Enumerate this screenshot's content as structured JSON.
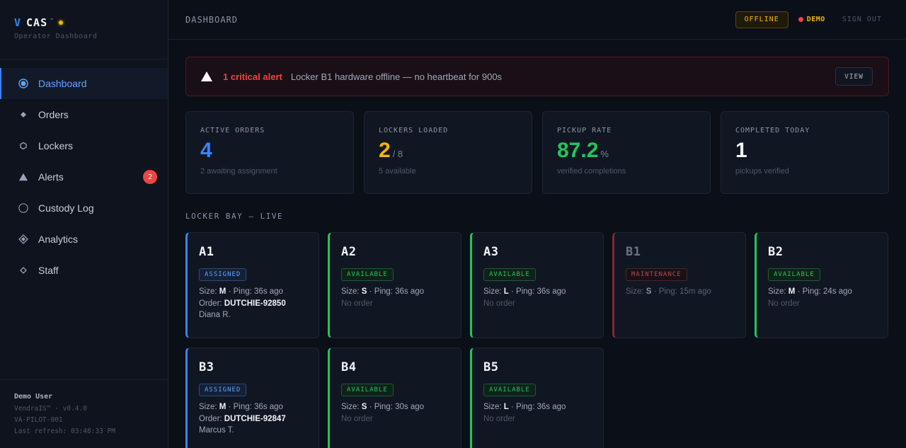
{
  "brand": {
    "v": "V",
    "name": "CAS",
    "tm": "™",
    "subtitle": "Operator Dashboard"
  },
  "nav": [
    {
      "label": "Dashboard",
      "icon": "radio-dot-icon",
      "active": true
    },
    {
      "label": "Orders",
      "icon": "diamond-icon"
    },
    {
      "label": "Lockers",
      "icon": "hexagon-icon"
    },
    {
      "label": "Alerts",
      "icon": "warning-triangle-icon",
      "badge": "2"
    },
    {
      "label": "Custody Log",
      "icon": "circle-icon"
    },
    {
      "label": "Analytics",
      "icon": "diamond-outline-icon"
    },
    {
      "label": "Staff",
      "icon": "small-diamond-icon"
    }
  ],
  "footer": {
    "user": "Demo User",
    "version": "VendraIS™ · v0.4.0",
    "site": "VA-PILOT-001",
    "refresh": "Last refresh: 03:48:33 PM"
  },
  "topbar": {
    "title": "DASHBOARD",
    "status": "OFFLINE",
    "demo": "DEMO",
    "signout": "SIGN OUT"
  },
  "alert": {
    "title": "1 critical alert",
    "message": "Locker B1 hardware offline — no heartbeat for 900s",
    "action": "VIEW"
  },
  "stats": [
    {
      "label": "ACTIVE ORDERS",
      "value": "4",
      "suffix": "",
      "sub": "2 awaiting assignment",
      "color": "#3b82f6"
    },
    {
      "label": "LOCKERS LOADED",
      "value": "2",
      "suffix": "/ 8",
      "sub": "5 available",
      "color": "#f5b400"
    },
    {
      "label": "PICKUP RATE",
      "value": "87.2",
      "suffix": "%",
      "sub": "verified completions",
      "color": "#22c55e"
    },
    {
      "label": "COMPLETED TODAY",
      "value": "1",
      "suffix": "",
      "sub": "pickups verified",
      "color": "#f2f4f8"
    }
  ],
  "bay": {
    "title": "LOCKER BAY — LIVE",
    "size_label": "Size:",
    "ping_label": "Ping:",
    "order_label": "Order:",
    "no_order": "No order",
    "lockers": [
      {
        "id": "A1",
        "status": "ASSIGNED",
        "state": "assigned",
        "size": "M",
        "ping": "36s ago",
        "order": "DUTCHIE-92850",
        "customer": "Diana R."
      },
      {
        "id": "A2",
        "status": "AVAILABLE",
        "state": "available",
        "size": "S",
        "ping": "36s ago"
      },
      {
        "id": "A3",
        "status": "AVAILABLE",
        "state": "available",
        "size": "L",
        "ping": "36s ago"
      },
      {
        "id": "B1",
        "status": "MAINTENANCE",
        "state": "maintenance",
        "size": "S",
        "ping": "15m ago"
      },
      {
        "id": "B2",
        "status": "AVAILABLE",
        "state": "available",
        "size": "M",
        "ping": "24s ago"
      },
      {
        "id": "B3",
        "status": "ASSIGNED",
        "state": "assigned",
        "size": "M",
        "ping": "36s ago",
        "order": "DUTCHIE-92847",
        "customer": "Marcus T."
      },
      {
        "id": "B4",
        "status": "AVAILABLE",
        "state": "available",
        "size": "S",
        "ping": "30s ago"
      },
      {
        "id": "B5",
        "status": "AVAILABLE",
        "state": "available",
        "size": "L",
        "ping": "36s ago"
      }
    ]
  }
}
